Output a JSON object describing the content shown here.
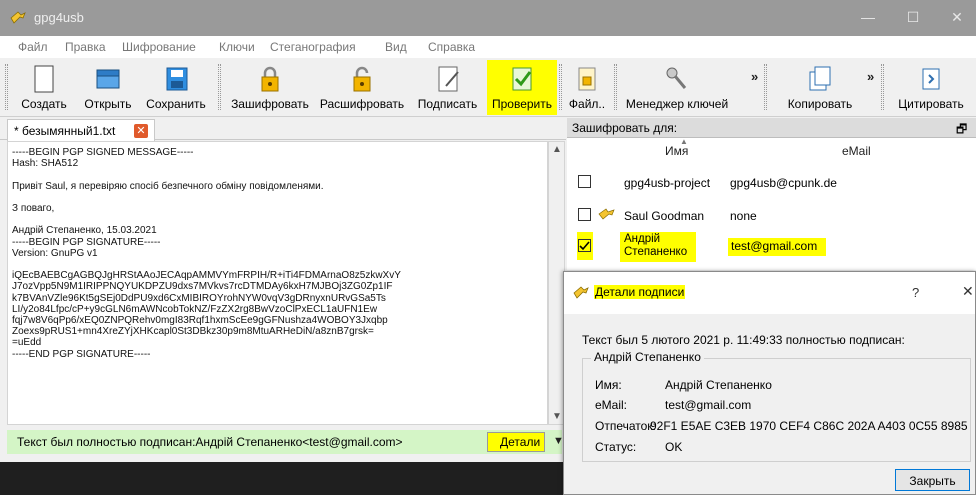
{
  "window": {
    "title": "gpg4usb"
  },
  "menu": [
    "Файл",
    "Правка",
    "Шифрование",
    "Ключи",
    "Стеганография",
    "Вид",
    "Справка"
  ],
  "toolbar": {
    "create": "Создать",
    "open": "Открыть",
    "save": "Сохранить",
    "encrypt": "Зашифровать",
    "decrypt": "Расшифровать",
    "sign": "Подписать",
    "verify": "Проверить",
    "file": "Файл..",
    "key_manager": "Менеджер ключей",
    "copy": "Копировать",
    "quote": "Цитировать",
    "overflow": "»"
  },
  "editor": {
    "tab_label": "* безымянный1.txt",
    "lines": [
      "-----BEGIN PGP SIGNED MESSAGE-----",
      "Hash: SHA512",
      "",
      "Привіт Saul, я перевіряю спосіб безпечного обміну повідомленями.",
      "",
      "З поваго,",
      "",
      "Андрій Степаненко, 15.03.2021",
      "-----BEGIN PGP SIGNATURE-----",
      "Version: GnuPG v1",
      "",
      "iQEcBAEBCgAGBQJgHRStAAoJECAqpAMMVYmFRPIH/R+iTi4FDMArnaO8z5zkwXvY",
      "J7ozVpp5N9M1IRIPPNQYUKDPZU9dxs7MVkvs7rcDTMDAy6kxH7MJBOj3ZG0Zp1IF",
      "k7BVAnVZle96Kt5gSEj0DdPU9xd6CxMIBIROYrohNYW0vqV3gDRnyxnURvGSa5Ts",
      "LI/y2o84Lfpc/cP+y9cGLN6mAWNcobTokNZ/FzZX2rg8BwVzoClPxECL1aUFN1Ew",
      "fqj7w8V6qPp6/xEQ0ZNPQRehv0mgI83Rqf1hxmScEe9gGFNushza4WOBOY3Jxqbp",
      "Zoexs9pRUS1+mn4XreZYjXHKcapl0St3DBkz30p9m8MtuARHeDiN/a8znB7grsk=",
      "=uEdd",
      "-----END PGP SIGNATURE-----"
    ]
  },
  "status": {
    "text": "Текст был полностью подписан:Андрій Степаненко<test@gmail.com>",
    "details_button": "Детали"
  },
  "keys_panel": {
    "title": "Зашифровать для:",
    "col_name": "Имя",
    "col_email": "eMail",
    "rows": [
      {
        "name": "gpg4usb-project",
        "email": "gpg4usb@cpunk.de",
        "checked": false
      },
      {
        "name": "Saul Goodman",
        "email": "none",
        "checked": false
      },
      {
        "name": "Андрій\nСтепаненко",
        "email": "test@gmail.com",
        "checked": true
      }
    ]
  },
  "dialog": {
    "title": "Детали подписи",
    "help": "?",
    "message": "Текст был 5 лютого 2021 р. 11:49:33 полностью подписан:",
    "signer_group": "Андрій Степаненко",
    "name_label": "Имя:",
    "name_value": "Андрій Степаненко",
    "email_label": "eMail:",
    "email_value": "test@gmail.com",
    "fp_label": "Отпечаток:",
    "fp_value": "92F1 E5AE C3EB 1970 CEF4 C86C 202A A403 0C55 8985",
    "status_label": "Статус:",
    "status_value": "OK",
    "close_button": "Закрыть"
  },
  "colors": {
    "highlight": "#ffff00",
    "status_bg": "#d4f5c6",
    "titlebar": "#9a9a9a"
  }
}
